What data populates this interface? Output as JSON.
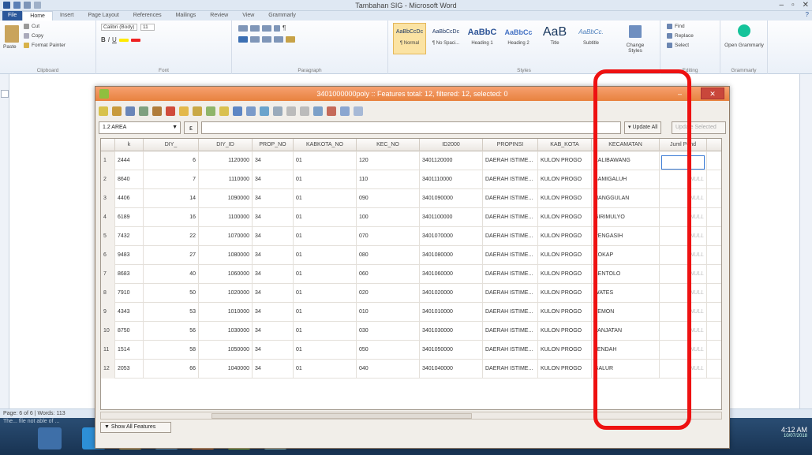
{
  "word": {
    "title": "Tambahan SIG - Microsoft Word",
    "tabs": [
      "File",
      "Home",
      "Insert",
      "Page Layout",
      "References",
      "Mailings",
      "Review",
      "View",
      "Grammarly"
    ],
    "clipboard": {
      "paste": "Paste",
      "cut": "Cut",
      "copy": "Copy",
      "format_painter": "Format Painter",
      "label": "Clipboard"
    },
    "font": {
      "name": "Calibri (Body)",
      "size": "11",
      "label": "Font"
    },
    "paragraph_label": "Paragraph",
    "styles": [
      {
        "sample": "AaBbCcDc",
        "name": "¶ Normal"
      },
      {
        "sample": "AaBbCcDc",
        "name": "¶ No Spaci..."
      },
      {
        "sample": "AaBbC",
        "name": "Heading 1"
      },
      {
        "sample": "AaBbCc",
        "name": "Heading 2"
      },
      {
        "sample": "AaB",
        "name": "Title"
      },
      {
        "sample": "AaBbCc.",
        "name": "Subtitle"
      }
    ],
    "styles_label": "Styles",
    "change_styles": "Change Styles",
    "editing": {
      "find": "Find",
      "replace": "Replace",
      "select": "Select",
      "label": "Editing"
    },
    "grammarly": {
      "open": "Open Grammarly",
      "label": "Grammarly"
    },
    "status": "Page: 6 of 6  |  Words: 113"
  },
  "qgis": {
    "title": "3401000000poly :: Features total: 12, filtered: 12, selected: 0",
    "field_select": "1.2 AREA",
    "expression_button": "ε",
    "update_all": "Update All",
    "update_selected": "Update Selected",
    "columns": [
      "",
      "k",
      "DIY_",
      "DIY_ID",
      "PROP_NO",
      "KABKOTA_NO",
      "KEC_NO",
      "ID2000",
      "PROPINSI",
      "KAB_KOTA",
      "KECAMATAN",
      "Juml Pend"
    ],
    "rows": [
      [
        "1",
        "2444",
        "6",
        "1120000",
        "34",
        "01",
        "120",
        "3401120000",
        "DAERAH ISTIME...",
        "KULON PROGO",
        "KALIBAWANG",
        ""
      ],
      [
        "2",
        "8640",
        "7",
        "1110000",
        "34",
        "01",
        "110",
        "3401110000",
        "DAERAH ISTIME...",
        "KULON PROGO",
        "SAMIGALUH",
        "NULL"
      ],
      [
        "3",
        "4406",
        "14",
        "1090000",
        "34",
        "01",
        "090",
        "3401090000",
        "DAERAH ISTIME...",
        "KULON PROGO",
        "NANGGULAN",
        "NULL"
      ],
      [
        "4",
        "6189",
        "16",
        "1100000",
        "34",
        "01",
        "100",
        "3401100000",
        "DAERAH ISTIME...",
        "KULON PROGO",
        "GIRIMULYO",
        "NULL"
      ],
      [
        "5",
        "7432",
        "22",
        "1070000",
        "34",
        "01",
        "070",
        "3401070000",
        "DAERAH ISTIME...",
        "KULON PROGO",
        "PENGASIH",
        "NULL"
      ],
      [
        "6",
        "9483",
        "27",
        "1080000",
        "34",
        "01",
        "080",
        "3401080000",
        "DAERAH ISTIME...",
        "KULON PROGO",
        "KOKAP",
        "NULL"
      ],
      [
        "7",
        "8683",
        "40",
        "1060000",
        "34",
        "01",
        "060",
        "3401060000",
        "DAERAH ISTIME...",
        "KULON PROGO",
        "SENTOLO",
        "NULL"
      ],
      [
        "8",
        "7910",
        "50",
        "1020000",
        "34",
        "01",
        "020",
        "3401020000",
        "DAERAH ISTIME...",
        "KULON PROGO",
        "WATES",
        "NULL"
      ],
      [
        "9",
        "4343",
        "53",
        "1010000",
        "34",
        "01",
        "010",
        "3401010000",
        "DAERAH ISTIME...",
        "KULON PROGO",
        "TEMON",
        "NULL"
      ],
      [
        "10",
        "8750",
        "56",
        "1030000",
        "34",
        "01",
        "030",
        "3401030000",
        "DAERAH ISTIME...",
        "KULON PROGO",
        "PANJATAN",
        "NULL"
      ],
      [
        "11",
        "1514",
        "58",
        "1050000",
        "34",
        "01",
        "050",
        "3401050000",
        "DAERAH ISTIME...",
        "KULON PROGO",
        "LENDAH",
        "NULL"
      ],
      [
        "12",
        "2053",
        "66",
        "1040000",
        "34",
        "01",
        "040",
        "3401040000",
        "DAERAH ISTIME...",
        "KULON PROGO",
        "GALUR",
        "NULL"
      ]
    ],
    "show_features": "Show All Features"
  },
  "taskbar": {
    "strip": "The... file not able of ...",
    "time": "4:12 AM",
    "date": "10/07/2018"
  },
  "colors": {
    "highlight": "#ee1111",
    "qgis_title": "#e8823e",
    "word_blue": "#2b579a"
  }
}
